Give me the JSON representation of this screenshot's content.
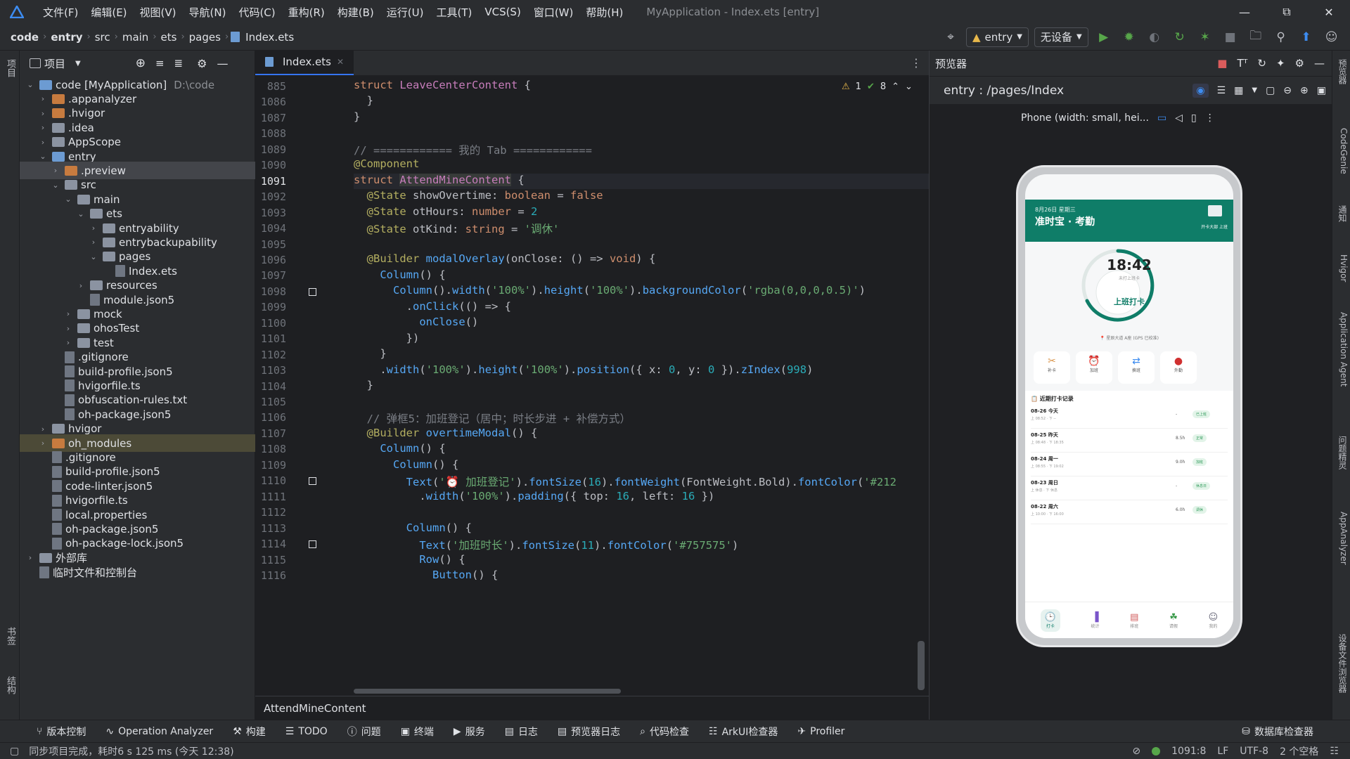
{
  "menu": {
    "items": [
      "文件(F)",
      "编辑(E)",
      "视图(V)",
      "导航(N)",
      "代码(C)",
      "重构(R)",
      "构建(B)",
      "运行(U)",
      "工具(T)",
      "VCS(S)",
      "窗口(W)",
      "帮助(H)"
    ],
    "title": "MyApplication - Index.ets [entry]"
  },
  "breadcrumb": [
    "code",
    "entry",
    "src",
    "main",
    "ets",
    "pages",
    "Index.ets"
  ],
  "toolbar": {
    "module": "entry",
    "device": "无设备"
  },
  "left_strip": {
    "project": "项目",
    "bookmarks": "书签",
    "structure": "结构"
  },
  "project": {
    "header": "项目",
    "root_name": "code [MyApplication]",
    "root_path": "D:\\code",
    "tree": [
      ".appanalyzer",
      ".hvigor",
      ".idea",
      "AppScope",
      "entry",
      ".preview",
      "src",
      "main",
      "ets",
      "entryability",
      "entrybackupability",
      "pages",
      "Index.ets",
      "resources",
      "module.json5",
      "mock",
      "ohosTest",
      "test",
      ".gitignore",
      "build-profile.json5",
      "hvigorfile.ts",
      "obfuscation-rules.txt",
      "oh-package.json5",
      "hvigor",
      "oh_modules",
      ".gitignore",
      "build-profile.json5",
      "code-linter.json5",
      "hvigorfile.ts",
      "local.properties",
      "oh-package.json5",
      "oh-package-lock.json5",
      "外部库",
      "临时文件和控制台"
    ]
  },
  "editor": {
    "tab": "Index.ets",
    "warnings": "1",
    "checks": "8",
    "lines": [
      "885",
      "1086",
      "1087",
      "1088",
      "1089",
      "1090",
      "1091",
      "1092",
      "1093",
      "1094",
      "1095",
      "1096",
      "1097",
      "1098",
      "1099",
      "1100",
      "1101",
      "1102",
      "1103",
      "1104",
      "1105",
      "1106",
      "1107",
      "1108",
      "1109",
      "1110",
      "1111",
      "1112",
      "1113",
      "1114",
      "1115",
      "1116"
    ],
    "current_line": "1091",
    "context": "AttendMineContent"
  },
  "preview": {
    "title": "预览器",
    "route": "entry : /pages/Index",
    "device": "Phone (width: small, hei..."
  },
  "phone": {
    "date": "8月26日 星期三",
    "app_title": "准时宝 · 考勤",
    "head_right": "开卡大部 上班",
    "time": "18:42",
    "time_sub": "未打上班卡",
    "punch_btn": "上班打卡",
    "location": "📍 星辰大道 A座 (GPS 已校准)",
    "quick": [
      "补卡",
      "加班",
      "换班",
      "外勤"
    ],
    "records_title": "📋 近期打卡记录",
    "records": [
      {
        "day": "08-26 今天",
        "detail": "上 08:52 · 下 --",
        "hours": "-",
        "tag": "已上班"
      },
      {
        "day": "08-25 昨天",
        "detail": "上 08:48 · 下 18:35",
        "hours": "8.5h",
        "tag": "正常"
      },
      {
        "day": "08-24 周一",
        "detail": "上 08:55 · 下 19:02",
        "hours": "9.0h",
        "tag": "加班"
      },
      {
        "day": "08-23 周日",
        "detail": "上 休息 · 下 休息",
        "hours": "-",
        "tag": "休息日"
      },
      {
        "day": "08-22 周六",
        "detail": "上 10:00 · 下 16:00",
        "hours": "6.0h",
        "tag": "调休"
      }
    ],
    "nav": [
      "打卡",
      "统计",
      "排班",
      "请假",
      "我的"
    ]
  },
  "right_strip": [
    "预览器",
    "CodeGenie",
    "通知",
    "Hvigor",
    "Application Agent",
    "问题精灵",
    "AppAnalyzer",
    "设备文件浏览器"
  ],
  "bottom_tools": [
    "版本控制",
    "Operation Analyzer",
    "构建",
    "TODO",
    "问题",
    "终端",
    "服务",
    "日志",
    "预览器日志",
    "代码检查",
    "ArkUI检查器",
    "Profiler",
    "数据库检查器"
  ],
  "status": {
    "message": "同步项目完成，耗时6 s 125 ms (今天 12:38)",
    "position": "1091:8",
    "line_sep": "LF",
    "encoding": "UTF-8",
    "indent": "2 个空格"
  }
}
